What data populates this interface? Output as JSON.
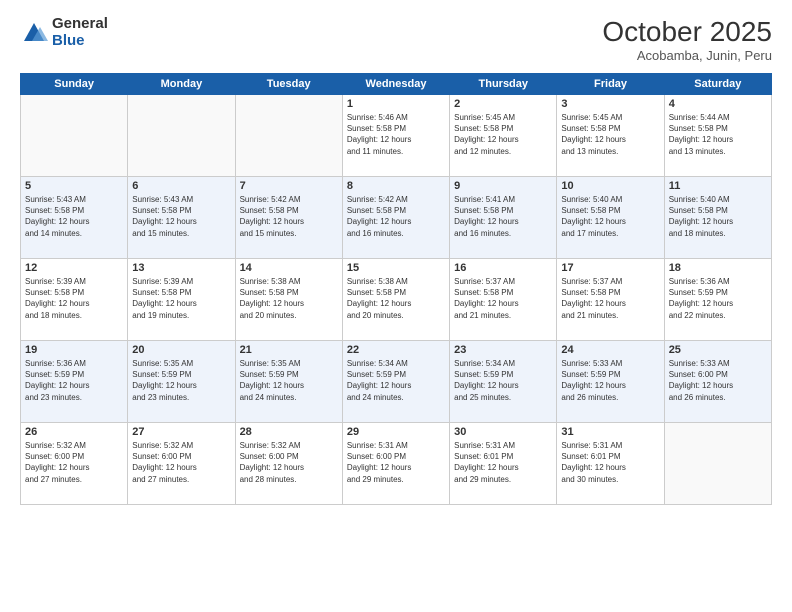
{
  "header": {
    "logo_general": "General",
    "logo_blue": "Blue",
    "month_title": "October 2025",
    "subtitle": "Acobamba, Junin, Peru"
  },
  "weekdays": [
    "Sunday",
    "Monday",
    "Tuesday",
    "Wednesday",
    "Thursday",
    "Friday",
    "Saturday"
  ],
  "weeks": [
    [
      {
        "day": "",
        "info": ""
      },
      {
        "day": "",
        "info": ""
      },
      {
        "day": "",
        "info": ""
      },
      {
        "day": "1",
        "info": "Sunrise: 5:46 AM\nSunset: 5:58 PM\nDaylight: 12 hours\nand 11 minutes."
      },
      {
        "day": "2",
        "info": "Sunrise: 5:45 AM\nSunset: 5:58 PM\nDaylight: 12 hours\nand 12 minutes."
      },
      {
        "day": "3",
        "info": "Sunrise: 5:45 AM\nSunset: 5:58 PM\nDaylight: 12 hours\nand 13 minutes."
      },
      {
        "day": "4",
        "info": "Sunrise: 5:44 AM\nSunset: 5:58 PM\nDaylight: 12 hours\nand 13 minutes."
      }
    ],
    [
      {
        "day": "5",
        "info": "Sunrise: 5:43 AM\nSunset: 5:58 PM\nDaylight: 12 hours\nand 14 minutes."
      },
      {
        "day": "6",
        "info": "Sunrise: 5:43 AM\nSunset: 5:58 PM\nDaylight: 12 hours\nand 15 minutes."
      },
      {
        "day": "7",
        "info": "Sunrise: 5:42 AM\nSunset: 5:58 PM\nDaylight: 12 hours\nand 15 minutes."
      },
      {
        "day": "8",
        "info": "Sunrise: 5:42 AM\nSunset: 5:58 PM\nDaylight: 12 hours\nand 16 minutes."
      },
      {
        "day": "9",
        "info": "Sunrise: 5:41 AM\nSunset: 5:58 PM\nDaylight: 12 hours\nand 16 minutes."
      },
      {
        "day": "10",
        "info": "Sunrise: 5:40 AM\nSunset: 5:58 PM\nDaylight: 12 hours\nand 17 minutes."
      },
      {
        "day": "11",
        "info": "Sunrise: 5:40 AM\nSunset: 5:58 PM\nDaylight: 12 hours\nand 18 minutes."
      }
    ],
    [
      {
        "day": "12",
        "info": "Sunrise: 5:39 AM\nSunset: 5:58 PM\nDaylight: 12 hours\nand 18 minutes."
      },
      {
        "day": "13",
        "info": "Sunrise: 5:39 AM\nSunset: 5:58 PM\nDaylight: 12 hours\nand 19 minutes."
      },
      {
        "day": "14",
        "info": "Sunrise: 5:38 AM\nSunset: 5:58 PM\nDaylight: 12 hours\nand 20 minutes."
      },
      {
        "day": "15",
        "info": "Sunrise: 5:38 AM\nSunset: 5:58 PM\nDaylight: 12 hours\nand 20 minutes."
      },
      {
        "day": "16",
        "info": "Sunrise: 5:37 AM\nSunset: 5:58 PM\nDaylight: 12 hours\nand 21 minutes."
      },
      {
        "day": "17",
        "info": "Sunrise: 5:37 AM\nSunset: 5:58 PM\nDaylight: 12 hours\nand 21 minutes."
      },
      {
        "day": "18",
        "info": "Sunrise: 5:36 AM\nSunset: 5:59 PM\nDaylight: 12 hours\nand 22 minutes."
      }
    ],
    [
      {
        "day": "19",
        "info": "Sunrise: 5:36 AM\nSunset: 5:59 PM\nDaylight: 12 hours\nand 23 minutes."
      },
      {
        "day": "20",
        "info": "Sunrise: 5:35 AM\nSunset: 5:59 PM\nDaylight: 12 hours\nand 23 minutes."
      },
      {
        "day": "21",
        "info": "Sunrise: 5:35 AM\nSunset: 5:59 PM\nDaylight: 12 hours\nand 24 minutes."
      },
      {
        "day": "22",
        "info": "Sunrise: 5:34 AM\nSunset: 5:59 PM\nDaylight: 12 hours\nand 24 minutes."
      },
      {
        "day": "23",
        "info": "Sunrise: 5:34 AM\nSunset: 5:59 PM\nDaylight: 12 hours\nand 25 minutes."
      },
      {
        "day": "24",
        "info": "Sunrise: 5:33 AM\nSunset: 5:59 PM\nDaylight: 12 hours\nand 26 minutes."
      },
      {
        "day": "25",
        "info": "Sunrise: 5:33 AM\nSunset: 6:00 PM\nDaylight: 12 hours\nand 26 minutes."
      }
    ],
    [
      {
        "day": "26",
        "info": "Sunrise: 5:32 AM\nSunset: 6:00 PM\nDaylight: 12 hours\nand 27 minutes."
      },
      {
        "day": "27",
        "info": "Sunrise: 5:32 AM\nSunset: 6:00 PM\nDaylight: 12 hours\nand 27 minutes."
      },
      {
        "day": "28",
        "info": "Sunrise: 5:32 AM\nSunset: 6:00 PM\nDaylight: 12 hours\nand 28 minutes."
      },
      {
        "day": "29",
        "info": "Sunrise: 5:31 AM\nSunset: 6:00 PM\nDaylight: 12 hours\nand 29 minutes."
      },
      {
        "day": "30",
        "info": "Sunrise: 5:31 AM\nSunset: 6:01 PM\nDaylight: 12 hours\nand 29 minutes."
      },
      {
        "day": "31",
        "info": "Sunrise: 5:31 AM\nSunset: 6:01 PM\nDaylight: 12 hours\nand 30 minutes."
      },
      {
        "day": "",
        "info": ""
      }
    ]
  ]
}
